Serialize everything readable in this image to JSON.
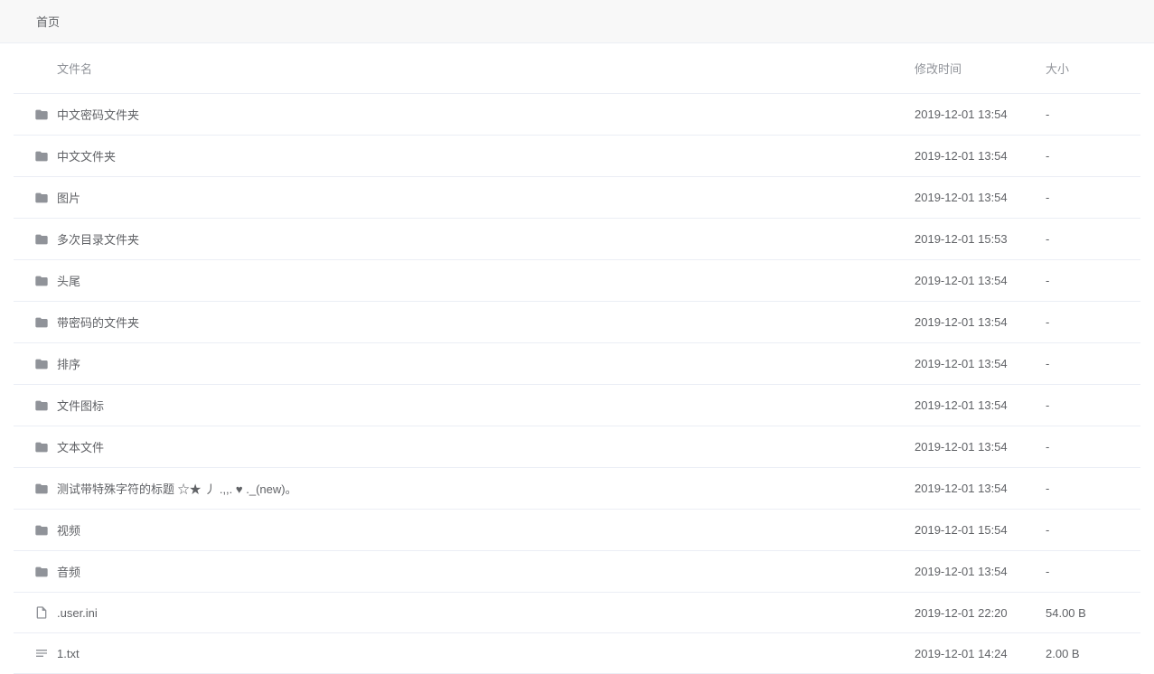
{
  "breadcrumb": {
    "home": "首页"
  },
  "table": {
    "headers": {
      "name": "文件名",
      "modified": "修改时间",
      "size": "大小"
    },
    "rows": [
      {
        "icon": "folder",
        "name": "中文密码文件夹",
        "modified": "2019-12-01 13:54",
        "size": "-"
      },
      {
        "icon": "folder",
        "name": "中文文件夹",
        "modified": "2019-12-01 13:54",
        "size": "-"
      },
      {
        "icon": "folder",
        "name": "图片",
        "modified": "2019-12-01 13:54",
        "size": "-"
      },
      {
        "icon": "folder",
        "name": "多次目录文件夹",
        "modified": "2019-12-01 15:53",
        "size": "-"
      },
      {
        "icon": "folder",
        "name": "头尾",
        "modified": "2019-12-01 13:54",
        "size": "-"
      },
      {
        "icon": "folder",
        "name": "带密码的文件夹",
        "modified": "2019-12-01 13:54",
        "size": "-"
      },
      {
        "icon": "folder",
        "name": "排序",
        "modified": "2019-12-01 13:54",
        "size": "-"
      },
      {
        "icon": "folder",
        "name": "文件图标",
        "modified": "2019-12-01 13:54",
        "size": "-"
      },
      {
        "icon": "folder",
        "name": "文本文件",
        "modified": "2019-12-01 13:54",
        "size": "-"
      },
      {
        "icon": "folder",
        "name": "测试带特殊字符的标题 ☆★ 丿 .,,. ♥ ._(new)。",
        "modified": "2019-12-01 13:54",
        "size": "-"
      },
      {
        "icon": "folder",
        "name": "视频",
        "modified": "2019-12-01 15:54",
        "size": "-"
      },
      {
        "icon": "folder",
        "name": "音频",
        "modified": "2019-12-01 13:54",
        "size": "-"
      },
      {
        "icon": "file",
        "name": ".user.ini",
        "modified": "2019-12-01 22:20",
        "size": "54.00 B"
      },
      {
        "icon": "text",
        "name": "1.txt",
        "modified": "2019-12-01 14:24",
        "size": "2.00 B"
      }
    ]
  }
}
